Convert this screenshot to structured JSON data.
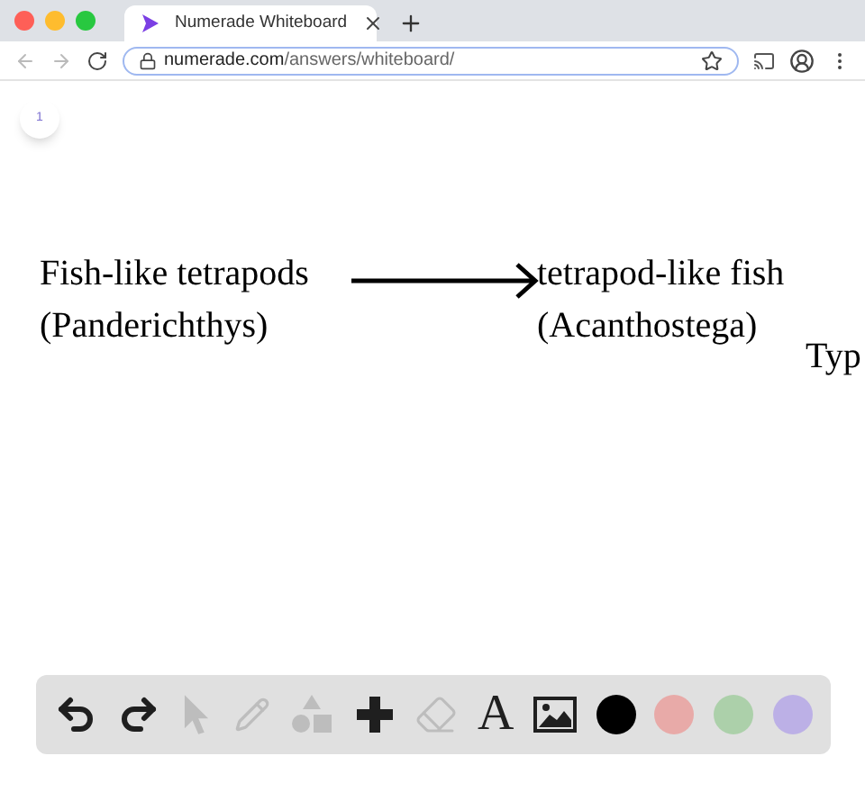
{
  "browser": {
    "tab_title": "Numerade Whiteboard",
    "url_domain": "numerade.com",
    "url_path": "/answers/whiteboard/"
  },
  "page_badge": "1",
  "canvas_texts": [
    {
      "lines": [
        "Fish-like tetrapods",
        "(Panderichthys)"
      ],
      "kind": "text"
    },
    {
      "kind": "arrow"
    },
    {
      "lines": [
        "tetrapod-like fish",
        "(Acanthostega)"
      ],
      "kind": "text"
    },
    {
      "lines": [
        "Typ"
      ],
      "kind": "text"
    }
  ],
  "tools": [
    {
      "kind": "undo",
      "disabled": false
    },
    {
      "kind": "redo",
      "disabled": false
    },
    {
      "kind": "select",
      "disabled": true
    },
    {
      "kind": "pencil",
      "disabled": true
    },
    {
      "kind": "shapes",
      "disabled": true
    },
    {
      "kind": "plus",
      "disabled": false
    },
    {
      "kind": "eraser",
      "disabled": true
    },
    {
      "kind": "text",
      "glyph": "A",
      "disabled": false
    },
    {
      "kind": "image",
      "disabled": false
    }
  ],
  "colors": [
    {
      "color": "#000000"
    },
    {
      "color": "#e8aaa8"
    },
    {
      "color": "#acd0aa"
    },
    {
      "color": "#bcb0e6"
    }
  ]
}
